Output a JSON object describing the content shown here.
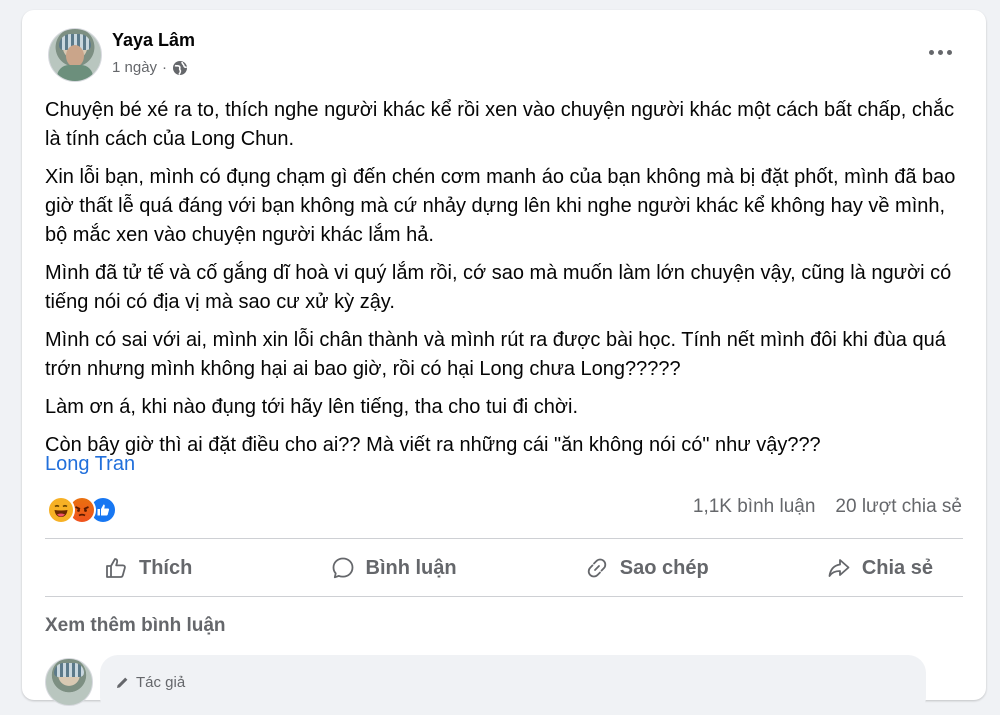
{
  "post": {
    "author": "Yaya Lâm",
    "time": "1 ngày",
    "separator": "·",
    "paragraphs": [
      "Chuyện bé xé ra to, thích nghe người khác kể rồi xen vào chuyện người khác một cách bất chấp, chắc là tính cách của Long Chun.",
      "Xin lỗi bạn, mình có đụng chạm gì đến chén cơm manh áo của bạn không mà bị đặt phốt, mình đã bao giờ thất lễ quá đáng với bạn không mà cứ nhảy dựng lên khi nghe người khác kể không hay về mình, bộ mắc xen vào chuyện người khác lắm hả.",
      "Mình đã tử tế và cố gắng dĩ hoà vi quý lắm rồi, cớ sao mà muốn làm lớn chuyện vậy, cũng là người có tiếng nói có địa vị mà sao cư xử kỳ zậy.",
      "Mình có sai với ai, mình xin lỗi chân thành và mình rút ra được bài học. Tính nết mình đôi khi đùa quá trớn nhưng mình không hại ai bao giờ, rồi có hại Long chưa Long?????",
      "Làm ơn á, khi nào đụng tới hãy lên tiếng, tha cho tui đi chời.",
      "Còn bây giờ thì ai đặt điều cho ai?? Mà viết ra những cái \"ăn không nói có\" như vậy???"
    ],
    "mention": "Long Tran"
  },
  "stats": {
    "reactions": [
      "haha",
      "angry",
      "like"
    ],
    "comments": "1,1K bình luận",
    "shares": "20 lượt chia sẻ"
  },
  "actions": {
    "like": "Thích",
    "comment": "Bình luận",
    "copy": "Sao chép",
    "share": "Chia sẻ"
  },
  "comments": {
    "see_more": "Xem thêm bình luận",
    "first_badge": "Tác giả"
  },
  "colors": {
    "link": "#216fdb",
    "secondary_text": "#65676b",
    "like_blue": "#1877f2",
    "haha_yellow": "#f7b125",
    "angry_orange": "#e9710f"
  }
}
